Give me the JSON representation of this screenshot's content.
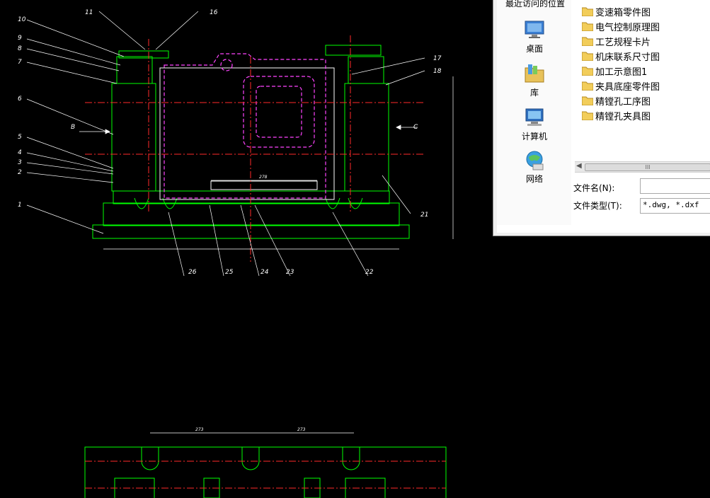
{
  "drawing": {
    "part_numbers_left": [
      "10",
      "9",
      "8",
      "7",
      "6",
      "5",
      "4",
      "3",
      "2",
      "1"
    ],
    "part_numbers_top": [
      "11",
      "16"
    ],
    "part_numbers_right": [
      "17",
      "18",
      "21"
    ],
    "part_numbers_bottom": [
      "26",
      "25",
      "24",
      "23",
      "22"
    ],
    "view_labels": [
      "B",
      "C"
    ],
    "dims_top": [
      "273",
      "273"
    ],
    "dim_mid": "278"
  },
  "dialog": {
    "recent_places": "最近访问的位置",
    "places": [
      {
        "label": "桌面",
        "icon": "desktop-icon"
      },
      {
        "label": "库",
        "icon": "library-icon"
      },
      {
        "label": "计算机",
        "icon": "computer-icon"
      },
      {
        "label": "网络",
        "icon": "network-icon"
      }
    ],
    "files": [
      {
        "name": "变速箱零件图",
        "icon": "folder-icon"
      },
      {
        "name": "电气控制原理图",
        "icon": "folder-icon"
      },
      {
        "name": "工艺规程卡片",
        "icon": "folder-icon"
      },
      {
        "name": "机床联系尺寸图",
        "icon": "folder-icon"
      },
      {
        "name": "加工示意图1",
        "icon": "folder-icon"
      },
      {
        "name": "夹具底座零件图",
        "icon": "folder-icon"
      },
      {
        "name": "精镗孔工序图",
        "icon": "folder-icon"
      },
      {
        "name": "精镗孔夹具图",
        "icon": "folder-icon"
      }
    ],
    "scroll_thumb": "III",
    "filename_label": "文件名(N):",
    "filename_value": "",
    "filetype_label": "文件类型(T):",
    "filetype_value": "*.dwg, *.dxf"
  }
}
